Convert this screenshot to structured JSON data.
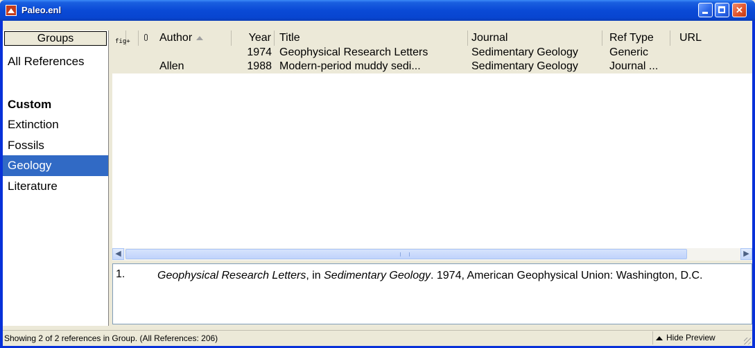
{
  "window": {
    "title": "Paleo.enl"
  },
  "groups": {
    "header": "Groups",
    "items": [
      {
        "label": "All References",
        "bold": false,
        "selected": false
      },
      {
        "label": "Custom",
        "bold": true,
        "selected": false
      },
      {
        "label": "Extinction",
        "bold": false,
        "selected": false
      },
      {
        "label": "Fossils",
        "bold": false,
        "selected": false
      },
      {
        "label": "Geology",
        "bold": false,
        "selected": true
      },
      {
        "label": "Literature",
        "bold": false,
        "selected": false
      }
    ]
  },
  "references": {
    "columns": {
      "fig": "fig+",
      "author": "Author",
      "year": "Year",
      "title": "Title",
      "journal": "Journal",
      "reftype": "Ref Type",
      "url": "URL"
    },
    "rows": [
      {
        "author": "",
        "year": "1974",
        "title": "Geophysical Research Letters",
        "journal": "Sedimentary Geology",
        "reftype": "Generic"
      },
      {
        "author": "Allen",
        "year": "1988",
        "title": "Modern-period muddy sedi...",
        "journal": "Sedimentary Geology",
        "reftype": "Journal ..."
      }
    ]
  },
  "preview": {
    "number": "1.",
    "title_italic": "Geophysical Research Letters",
    "sep1": ", in ",
    "journal_italic": "Sedimentary Geology",
    "rest": ". 1974, American Geophysical Union: Washington, D.C."
  },
  "status": {
    "text": "Showing 2 of 2 references in Group. (All References: 206)",
    "hide_preview": "Hide Preview"
  },
  "colors": {
    "selection": "#316ac5",
    "titlebar": "#0a4ad6",
    "row_bg": "#ece9d8"
  }
}
